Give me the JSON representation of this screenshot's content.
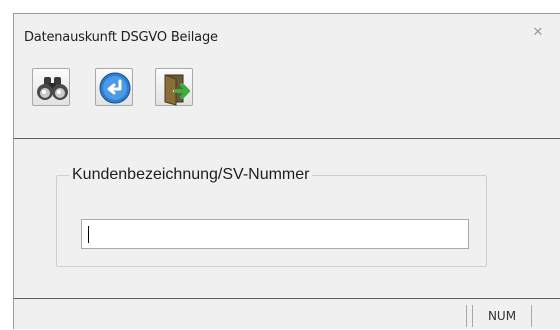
{
  "window": {
    "title": "Datenauskunft DSGVO Beilage",
    "close_icon": "close-x-icon"
  },
  "toolbar": {
    "buttons": [
      {
        "icon": "binoculars-icon"
      },
      {
        "icon": "back-arrow-icon"
      },
      {
        "icon": "exit-door-icon"
      }
    ]
  },
  "form": {
    "group_label": "Kundenbezeichnung/SV-Nummer",
    "customer_value": ""
  },
  "statusbar": {
    "num_indicator": "NUM"
  },
  "colors": {
    "window_bg": "#f0f0f0",
    "separator": "#5e5e5e",
    "back_button_blue": "#2a7fd0",
    "exit_arrow_green": "#3cae3c"
  }
}
